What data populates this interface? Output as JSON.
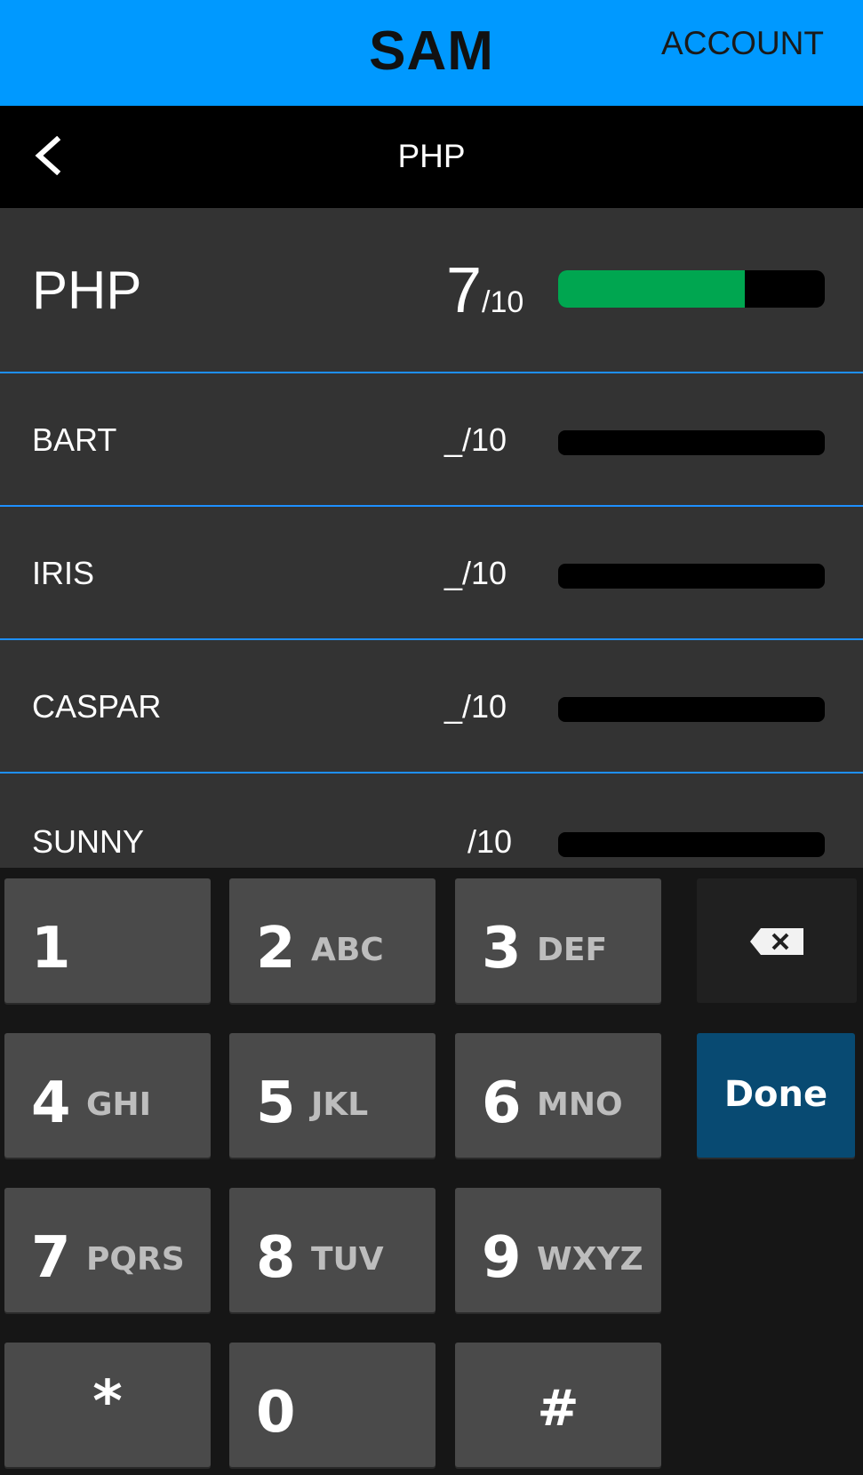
{
  "header": {
    "title": "SAM",
    "account_label": "ACCOUNT"
  },
  "nav": {
    "title": "PHP",
    "back_icon": "chevron-left-icon"
  },
  "colors": {
    "header_bg": "#0099ff",
    "accent_line": "#1e90ff",
    "progress_fill": "#00a650",
    "done_key": "#084a72"
  },
  "summary": {
    "name": "PHP",
    "score": "7",
    "denominator": "/10",
    "progress": 0.7
  },
  "people": [
    {
      "name": "BART",
      "score": "_",
      "denominator": "/10",
      "progress": 0
    },
    {
      "name": "IRIS",
      "score": "_",
      "denominator": "/10",
      "progress": 0
    },
    {
      "name": "CASPAR",
      "score": "_",
      "denominator": "/10",
      "progress": 0
    },
    {
      "name": "SUNNY",
      "score": "",
      "denominator": "/10",
      "progress": 0
    }
  ],
  "keyboard": {
    "keys": [
      {
        "num": "1",
        "letters": ""
      },
      {
        "num": "2",
        "letters": "ABC"
      },
      {
        "num": "3",
        "letters": "DEF"
      },
      {
        "num": "4",
        "letters": "GHI"
      },
      {
        "num": "5",
        "letters": "JKL"
      },
      {
        "num": "6",
        "letters": "MNO"
      },
      {
        "num": "7",
        "letters": "PQRS"
      },
      {
        "num": "8",
        "letters": "TUV"
      },
      {
        "num": "9",
        "letters": "WXYZ"
      },
      {
        "num": "*",
        "letters": ""
      },
      {
        "num": "0",
        "letters": ""
      },
      {
        "num": "#",
        "letters": ""
      }
    ],
    "done_label": "Done",
    "backspace_icon": "backspace-icon"
  }
}
